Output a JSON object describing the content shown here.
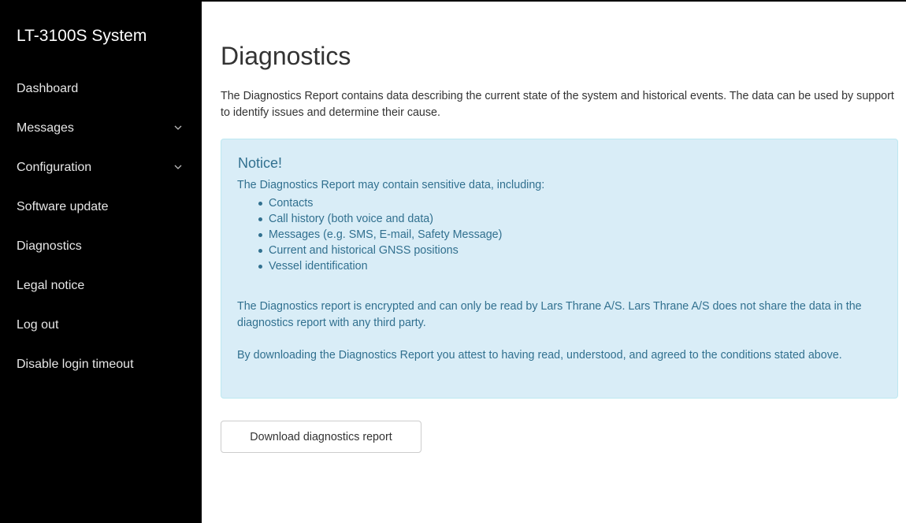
{
  "sidebar": {
    "brand": "LT-3100S System",
    "items": [
      {
        "label": "Dashboard"
      },
      {
        "label": "Messages",
        "icon": "chevron-down-icon"
      },
      {
        "label": "Configuration",
        "icon": "chevron-down-icon"
      },
      {
        "label": "Software update"
      },
      {
        "label": "Diagnostics"
      },
      {
        "label": "Legal notice"
      },
      {
        "label": "Log out"
      },
      {
        "label": "Disable login timeout"
      }
    ]
  },
  "main": {
    "title": "Diagnostics",
    "intro": "The Diagnostics Report contains data describing the current state of the system and historical events. The data can be used by support to identify issues and determine their cause.",
    "notice": {
      "title": "Notice!",
      "lead": "The Diagnostics Report may contain sensitive data, including:",
      "items": [
        "Contacts",
        "Call history (both voice and data)",
        "Messages (e.g. SMS, E-mail, Safety Message)",
        "Current and historical GNSS positions",
        "Vessel identification"
      ],
      "encryption_text": "The Diagnostics report is encrypted and can only be read by Lars Thrane A/S. Lars Thrane A/S does not share the data in the diagnostics report with any third party.",
      "agreement_text": "By downloading the Diagnostics Report you attest to having read, understood, and agreed to the conditions stated above."
    },
    "download_button": "Download diagnostics report"
  },
  "colors": {
    "sidebar_bg": "#000000",
    "notice_bg": "#d9edf7",
    "notice_text": "#31708f",
    "notice_border": "#bce8f1"
  }
}
